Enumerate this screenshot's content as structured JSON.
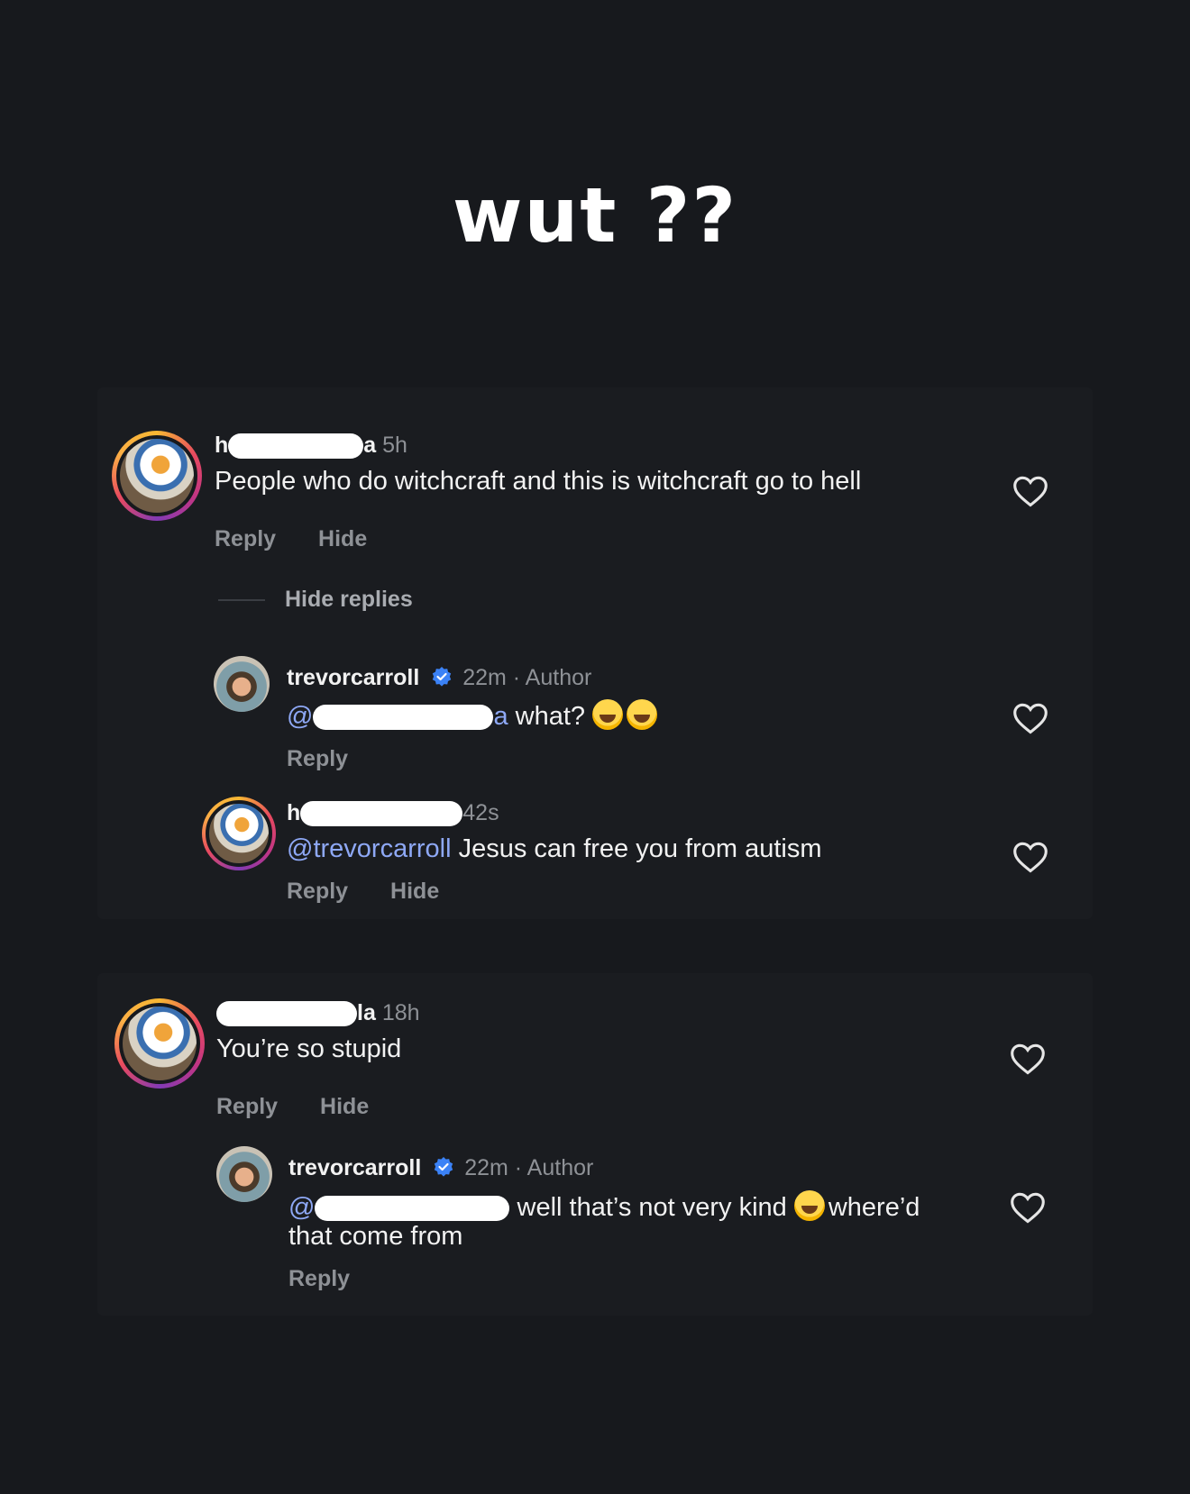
{
  "caption": "wut ??",
  "threads": [
    {
      "comment": {
        "name_prefix": "h",
        "name_suffix": "a",
        "time": "5h",
        "text": "People who do witchcraft and this is witchcraft go to hell",
        "actions": [
          "Reply",
          "Hide"
        ]
      },
      "hide_replies_label": "Hide replies",
      "replies": [
        {
          "username": "trevorcarroll",
          "time": "22m · Author",
          "mention_prefix": "@",
          "mention_suffix": "a",
          "text": " what?",
          "actions": [
            "Reply"
          ]
        },
        {
          "name_prefix": "h",
          "time": "42s",
          "mention": "@trevorcarroll",
          "text": " Jesus can free you from autism",
          "actions": [
            "Reply",
            "Hide"
          ]
        }
      ]
    },
    {
      "comment": {
        "name_suffix": "la",
        "time": "18h",
        "text": "You’re so stupid",
        "actions": [
          "Reply",
          "Hide"
        ]
      },
      "replies": [
        {
          "username": "trevorcarroll",
          "time": "22m · Author",
          "mention_prefix": "@",
          "text_line1": "well that’s not very kind",
          "text_after_emoji": "where’d",
          "text_line2": "that come from",
          "actions": [
            "Reply"
          ]
        }
      ]
    }
  ],
  "colors": {
    "background": "#17191d",
    "mention": "#8ea8f5",
    "verified": "#3b82f6",
    "muted": "#8e9196"
  },
  "icons": [
    "heart-icon",
    "verified-badge-icon",
    "laughing-emoji-icon"
  ]
}
